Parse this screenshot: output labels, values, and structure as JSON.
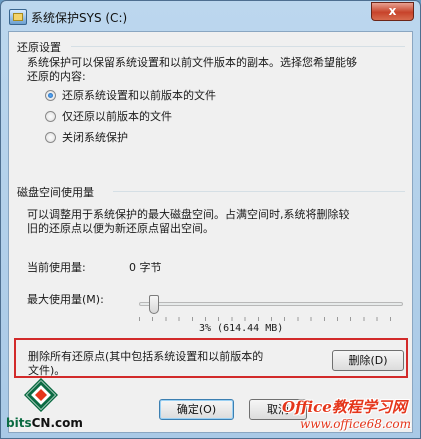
{
  "window": {
    "title": "系统保护SYS (C:)",
    "close_glyph": "x"
  },
  "restore_settings": {
    "heading": "还原设置",
    "description_line1": "系统保护可以保留系统设置和以前文件版本的副本。选择您希望能够",
    "description_line2": "还原的内容:",
    "options": [
      {
        "label": "还原系统设置和以前版本的文件",
        "checked": true
      },
      {
        "label": "仅还原以前版本的文件",
        "checked": false
      },
      {
        "label": "关闭系统保护",
        "checked": false
      }
    ]
  },
  "disk_usage": {
    "heading": "磁盘空间使用量",
    "description_line1": "可以调整用于系统保护的最大磁盘空间。占满空间时,系统将删除较",
    "description_line2": "旧的还原点以便为新还原点留出空间。",
    "current_label": "当前使用量:",
    "current_value": "0 字节",
    "max_label": "最大使用量(M):",
    "max_percent_value": 0.03,
    "percent_text": "3% (614.44 MB)"
  },
  "delete_section": {
    "text_line1": "删除所有还原点(其中包括系统设置和以前版本的",
    "text_line2": "文件)。",
    "button_label": "删除(D)"
  },
  "footer": {
    "ok_label": "确定(O)",
    "cancel_label": "取消"
  },
  "watermarks": {
    "left_text_a": "bits",
    "left_text_b": "CN.com",
    "right_text": "Office教程学习网",
    "right_url": "www.office68.com"
  },
  "colors": {
    "highlight_border": "#d22a2a",
    "watermark_red": "#e5361b",
    "watermark_green": "#0b6b42"
  }
}
